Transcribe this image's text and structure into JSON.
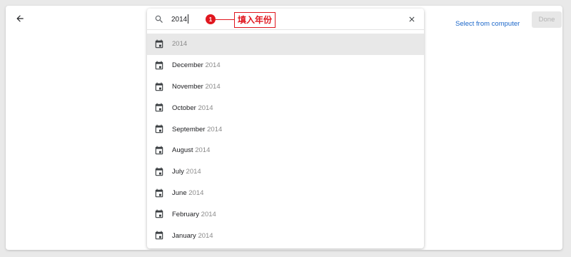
{
  "toolbar": {
    "select_from_computer": "Select from computer",
    "done_label": "Done"
  },
  "search": {
    "value": "2014",
    "placeholder": ""
  },
  "annotation": {
    "step_number": "1",
    "note": "填入年份"
  },
  "results": [
    {
      "month": "",
      "year": "2014",
      "highlighted": true
    },
    {
      "month": "December",
      "year": "2014",
      "highlighted": false
    },
    {
      "month": "November",
      "year": "2014",
      "highlighted": false
    },
    {
      "month": "October",
      "year": "2014",
      "highlighted": false
    },
    {
      "month": "September",
      "year": "2014",
      "highlighted": false
    },
    {
      "month": "August",
      "year": "2014",
      "highlighted": false
    },
    {
      "month": "July",
      "year": "2014",
      "highlighted": false
    },
    {
      "month": "June",
      "year": "2014",
      "highlighted": false
    },
    {
      "month": "February",
      "year": "2014",
      "highlighted": false
    },
    {
      "month": "January",
      "year": "2014",
      "highlighted": false
    }
  ],
  "icons": {
    "back": "arrow-back-icon",
    "search": "search-icon",
    "clear": "close-icon",
    "result": "calendar-icon"
  },
  "colors": {
    "link": "#1a66c9",
    "annotation": "#e0171f",
    "highlight_row": "#e8e8e8",
    "done_disabled_bg": "#e7e7e7"
  }
}
